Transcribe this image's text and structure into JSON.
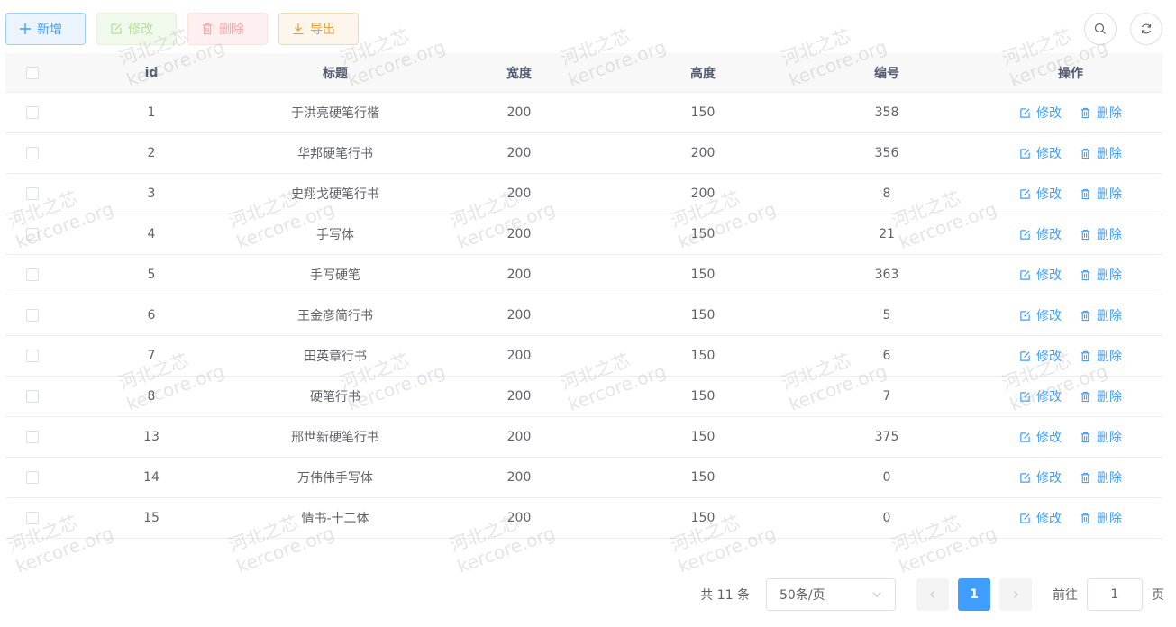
{
  "toolbar": {
    "add_label": "新增",
    "edit_label": "修改",
    "delete_label": "删除",
    "export_label": "导出"
  },
  "table": {
    "headers": {
      "id": "id",
      "title": "标题",
      "width": "宽度",
      "height": "高度",
      "code": "编号",
      "ops": "操作"
    },
    "op_edit": "修改",
    "op_delete": "删除",
    "rows": [
      {
        "id": "1",
        "title": "于洪亮硬笔行楷",
        "width": "200",
        "height": "150",
        "code": "358"
      },
      {
        "id": "2",
        "title": "华邦硬笔行书",
        "width": "200",
        "height": "200",
        "code": "356"
      },
      {
        "id": "3",
        "title": "史翔戈硬笔行书",
        "width": "200",
        "height": "200",
        "code": "8"
      },
      {
        "id": "4",
        "title": "手写体",
        "width": "200",
        "height": "150",
        "code": "21"
      },
      {
        "id": "5",
        "title": "手写硬笔",
        "width": "200",
        "height": "150",
        "code": "363"
      },
      {
        "id": "6",
        "title": "王金彦简行书",
        "width": "200",
        "height": "150",
        "code": "5"
      },
      {
        "id": "7",
        "title": "田英章行书",
        "width": "200",
        "height": "150",
        "code": "6"
      },
      {
        "id": "8",
        "title": "硬笔行书",
        "width": "200",
        "height": "150",
        "code": "7"
      },
      {
        "id": "13",
        "title": "邢世新硬笔行书",
        "width": "200",
        "height": "150",
        "code": "375"
      },
      {
        "id": "14",
        "title": "万伟伟手写体",
        "width": "200",
        "height": "150",
        "code": "0"
      },
      {
        "id": "15",
        "title": "情书-十二体",
        "width": "200",
        "height": "150",
        "code": "0"
      }
    ]
  },
  "pagination": {
    "total": "共 11 条",
    "page_size": "50条/页",
    "current_page": "1",
    "goto_label": "前往",
    "goto_value": "1",
    "page_suffix": "页"
  },
  "watermark": {
    "line1": "河北之芯",
    "line2": "kercore.org"
  },
  "colors": {
    "primary": "#409eff",
    "success_light": "#b3e19d",
    "danger_light": "#f9a7a7",
    "warning": "#e6a23c"
  }
}
